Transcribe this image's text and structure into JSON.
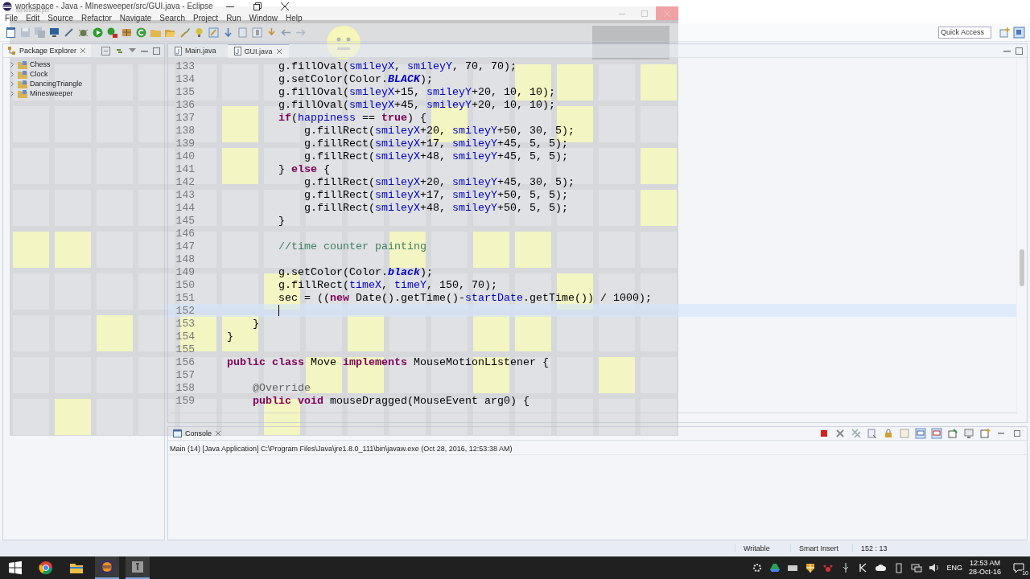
{
  "window": {
    "title": "workspace - Java - MInesweeper/src/GUI.java - Eclipse"
  },
  "menu": [
    "File",
    "Edit",
    "Source",
    "Refactor",
    "Navigate",
    "Search",
    "Project",
    "Run",
    "Window",
    "Help"
  ],
  "quick_access": {
    "placeholder": "Quick Access"
  },
  "package_explorer": {
    "title": "Package Explorer",
    "projects": [
      {
        "label": "Chess",
        "expanded": false
      },
      {
        "label": "Clock",
        "expanded": false
      },
      {
        "label": "DancingTriangle",
        "expanded": false
      },
      {
        "label": "Minesweeper",
        "expanded": false
      }
    ]
  },
  "editor": {
    "tabs": [
      {
        "label": "Main.java",
        "selected": false
      },
      {
        "label": "GUI.java",
        "selected": true
      }
    ],
    "lines": [
      {
        "number": "133",
        "current": false,
        "tokens": [
          {
            "kind": "plain",
            "text": "            g.fillOval("
          },
          {
            "kind": "field",
            "text": "smileyX"
          },
          {
            "kind": "plain",
            "text": ", "
          },
          {
            "kind": "field",
            "text": "smileyY"
          },
          {
            "kind": "plain",
            "text": ", 70, 70);"
          }
        ]
      },
      {
        "number": "134",
        "current": false,
        "tokens": [
          {
            "kind": "plain",
            "text": "            g.setColor(Color."
          },
          {
            "kind": "static",
            "text": "BLACK"
          },
          {
            "kind": "plain",
            "text": ");"
          }
        ]
      },
      {
        "number": "135",
        "current": false,
        "tokens": [
          {
            "kind": "plain",
            "text": "            g.fillOval("
          },
          {
            "kind": "field",
            "text": "smileyX"
          },
          {
            "kind": "plain",
            "text": "+15, "
          },
          {
            "kind": "field",
            "text": "smileyY"
          },
          {
            "kind": "plain",
            "text": "+20, 10, 10);"
          }
        ]
      },
      {
        "number": "136",
        "current": false,
        "tokens": [
          {
            "kind": "plain",
            "text": "            g.fillOval("
          },
          {
            "kind": "field",
            "text": "smileyX"
          },
          {
            "kind": "plain",
            "text": "+45, "
          },
          {
            "kind": "field",
            "text": "smileyY"
          },
          {
            "kind": "plain",
            "text": "+20, 10, 10);"
          }
        ]
      },
      {
        "number": "137",
        "current": false,
        "tokens": [
          {
            "kind": "keyword",
            "text": "            if"
          },
          {
            "kind": "plain",
            "text": "("
          },
          {
            "kind": "field",
            "text": "happiness"
          },
          {
            "kind": "plain",
            "text": " == "
          },
          {
            "kind": "keyword",
            "text": "true"
          },
          {
            "kind": "plain",
            "text": ") {"
          }
        ]
      },
      {
        "number": "138",
        "current": false,
        "tokens": [
          {
            "kind": "plain",
            "text": "                g.fillRect("
          },
          {
            "kind": "field",
            "text": "smileyX"
          },
          {
            "kind": "plain",
            "text": "+20, "
          },
          {
            "kind": "field",
            "text": "smileyY"
          },
          {
            "kind": "plain",
            "text": "+50, 30, 5);"
          }
        ]
      },
      {
        "number": "139",
        "current": false,
        "tokens": [
          {
            "kind": "plain",
            "text": "                g.fillRect("
          },
          {
            "kind": "field",
            "text": "smileyX"
          },
          {
            "kind": "plain",
            "text": "+17, "
          },
          {
            "kind": "field",
            "text": "smileyY"
          },
          {
            "kind": "plain",
            "text": "+45, 5, 5);"
          }
        ]
      },
      {
        "number": "140",
        "current": false,
        "tokens": [
          {
            "kind": "plain",
            "text": "                g.fillRect("
          },
          {
            "kind": "field",
            "text": "smileyX"
          },
          {
            "kind": "plain",
            "text": "+48, "
          },
          {
            "kind": "field",
            "text": "smileyY"
          },
          {
            "kind": "plain",
            "text": "+45, 5, 5);"
          }
        ]
      },
      {
        "number": "141",
        "current": false,
        "tokens": [
          {
            "kind": "plain",
            "text": "            } "
          },
          {
            "kind": "keyword",
            "text": "else"
          },
          {
            "kind": "plain",
            "text": " {"
          }
        ]
      },
      {
        "number": "142",
        "current": false,
        "tokens": [
          {
            "kind": "plain",
            "text": "                g.fillRect("
          },
          {
            "kind": "field",
            "text": "smileyX"
          },
          {
            "kind": "plain",
            "text": "+20, "
          },
          {
            "kind": "field",
            "text": "smileyY"
          },
          {
            "kind": "plain",
            "text": "+45, 30, 5);"
          }
        ]
      },
      {
        "number": "143",
        "current": false,
        "tokens": [
          {
            "kind": "plain",
            "text": "                g.fillRect("
          },
          {
            "kind": "field",
            "text": "smileyX"
          },
          {
            "kind": "plain",
            "text": "+17, "
          },
          {
            "kind": "field",
            "text": "smileyY"
          },
          {
            "kind": "plain",
            "text": "+50, 5, 5);"
          }
        ]
      },
      {
        "number": "144",
        "current": false,
        "tokens": [
          {
            "kind": "plain",
            "text": "                g.fillRect("
          },
          {
            "kind": "field",
            "text": "smileyX"
          },
          {
            "kind": "plain",
            "text": "+48, "
          },
          {
            "kind": "field",
            "text": "smileyY"
          },
          {
            "kind": "plain",
            "text": "+50, 5, 5);"
          }
        ]
      },
      {
        "number": "145",
        "current": false,
        "tokens": [
          {
            "kind": "plain",
            "text": "            }"
          }
        ]
      },
      {
        "number": "146",
        "current": false
      },
      {
        "number": "147",
        "current": false,
        "tokens": [
          {
            "kind": "comment",
            "text": "            //time counter painting"
          }
        ]
      },
      {
        "number": "148",
        "current": false
      },
      {
        "number": "149",
        "current": false,
        "tokens": [
          {
            "kind": "plain",
            "text": "            g.setColor(Color."
          },
          {
            "kind": "static",
            "text": "black"
          },
          {
            "kind": "plain",
            "text": ");"
          }
        ]
      },
      {
        "number": "150",
        "current": false,
        "tokens": [
          {
            "kind": "plain",
            "text": "            g.fillRect("
          },
          {
            "kind": "field",
            "text": "timeX"
          },
          {
            "kind": "plain",
            "text": ", "
          },
          {
            "kind": "field",
            "text": "timeY"
          },
          {
            "kind": "plain",
            "text": ", 150, 70);"
          }
        ]
      },
      {
        "number": "151",
        "current": false,
        "tokens": [
          {
            "kind": "plain",
            "text": "            sec = (("
          },
          {
            "kind": "keyword",
            "text": "new"
          },
          {
            "kind": "plain",
            "text": " Date().getTime()-"
          },
          {
            "kind": "field",
            "text": "startDate"
          },
          {
            "kind": "plain",
            "text": ".getTime()) / 1000);"
          }
        ]
      },
      {
        "number": "152",
        "current": true
      },
      {
        "number": "153",
        "current": false,
        "tokens": [
          {
            "kind": "plain",
            "text": "        }"
          }
        ]
      },
      {
        "number": "154",
        "current": false,
        "tokens": [
          {
            "kind": "plain",
            "text": "    }"
          }
        ]
      },
      {
        "number": "155",
        "current": false
      },
      {
        "number": "156",
        "current": false,
        "tokens": [
          {
            "kind": "keyword",
            "text": "    public class"
          },
          {
            "kind": "plain",
            "text": " Move "
          },
          {
            "kind": "keyword",
            "text": "implements"
          },
          {
            "kind": "plain",
            "text": " MouseMotionListener {"
          }
        ]
      },
      {
        "number": "157",
        "current": false
      },
      {
        "number": "158",
        "current": false,
        "tokens": [
          {
            "kind": "annotation",
            "text": "        @Override"
          }
        ]
      },
      {
        "number": "159",
        "current": false,
        "tokens": [
          {
            "kind": "keyword",
            "text": "        public void"
          },
          {
            "kind": "plain",
            "text": " mouseDragged(MouseEvent arg0) {"
          }
        ]
      }
    ]
  },
  "console": {
    "title": "Console",
    "description": "Main (14) [Java Application] C:\\Program Files\\Java\\jre1.8.0_111\\bin\\javaw.exe (Oct 28, 2016, 12:53:38 AM)"
  },
  "status_bar": {
    "mode": "Writable",
    "insert": "Smart Insert",
    "position": "152 : 13"
  },
  "taskbar": {
    "language": "ENG",
    "time": "12:53 AM",
    "date": "28-Oct-16",
    "notifications": "10"
  },
  "game": {
    "title": "Minesweeper",
    "rows": [
      {
        "cells": [
          {
            "lit": false
          },
          {
            "lit": false
          },
          {
            "lit": false
          },
          {
            "lit": false
          },
          {
            "lit": false
          },
          {
            "lit": false
          },
          {
            "lit": false
          },
          {
            "lit": false
          },
          {
            "lit": false
          },
          {
            "lit": false
          },
          {
            "lit": false
          },
          {
            "lit": false
          },
          {
            "lit": true
          },
          {
            "lit": true
          },
          {
            "lit": false
          },
          {
            "lit": true
          }
        ]
      },
      {
        "cells": [
          {
            "lit": false
          },
          {
            "lit": false
          },
          {
            "lit": false
          },
          {
            "lit": false
          },
          {
            "lit": false
          },
          {
            "lit": true
          },
          {
            "lit": false
          },
          {
            "lit": false
          },
          {
            "lit": false
          },
          {
            "lit": false
          },
          {
            "lit": true
          },
          {
            "lit": false
          },
          {
            "lit": false
          },
          {
            "lit": true
          },
          {
            "lit": false
          },
          {
            "lit": false
          }
        ]
      },
      {
        "cells": [
          {
            "lit": false
          },
          {
            "lit": false
          },
          {
            "lit": false
          },
          {
            "lit": false
          },
          {
            "lit": false
          },
          {
            "lit": true
          },
          {
            "lit": false
          },
          {
            "lit": false
          },
          {
            "lit": false
          },
          {
            "lit": false
          },
          {
            "lit": false
          },
          {
            "lit": false
          },
          {
            "lit": false
          },
          {
            "lit": false
          },
          {
            "lit": false
          },
          {
            "lit": true
          }
        ]
      },
      {
        "cells": [
          {
            "lit": false
          },
          {
            "lit": false
          },
          {
            "lit": false
          },
          {
            "lit": false
          },
          {
            "lit": false
          },
          {
            "lit": false
          },
          {
            "lit": false
          },
          {
            "lit": false
          },
          {
            "lit": false
          },
          {
            "lit": false
          },
          {
            "lit": false
          },
          {
            "lit": false
          },
          {
            "lit": false
          },
          {
            "lit": false
          },
          {
            "lit": false
          },
          {
            "lit": true
          }
        ]
      },
      {
        "cells": [
          {
            "lit": true
          },
          {
            "lit": true
          },
          {
            "lit": false
          },
          {
            "lit": false
          },
          {
            "lit": false
          },
          {
            "lit": false
          },
          {
            "lit": false
          },
          {
            "lit": false
          },
          {
            "lit": false
          },
          {
            "lit": true
          },
          {
            "lit": false
          },
          {
            "lit": true
          },
          {
            "lit": true
          },
          {
            "lit": false
          },
          {
            "lit": false
          },
          {
            "lit": false
          }
        ]
      },
      {
        "cells": [
          {
            "lit": false
          },
          {
            "lit": false
          },
          {
            "lit": false
          },
          {
            "lit": false
          },
          {
            "lit": false
          },
          {
            "lit": false
          },
          {
            "lit": true
          },
          {
            "lit": false
          },
          {
            "lit": false
          },
          {
            "lit": false
          },
          {
            "lit": false
          },
          {
            "lit": false
          },
          {
            "lit": false
          },
          {
            "lit": true
          },
          {
            "lit": false
          },
          {
            "lit": false
          }
        ]
      },
      {
        "cells": [
          {
            "lit": false
          },
          {
            "lit": false
          },
          {
            "lit": true
          },
          {
            "lit": false
          },
          {
            "lit": true
          },
          {
            "lit": true
          },
          {
            "lit": false
          },
          {
            "lit": false
          },
          {
            "lit": true
          },
          {
            "lit": false
          },
          {
            "lit": false
          },
          {
            "lit": true
          },
          {
            "lit": true
          },
          {
            "lit": false
          },
          {
            "lit": false
          },
          {
            "lit": false
          }
        ]
      },
      {
        "cells": [
          {
            "lit": false
          },
          {
            "lit": false
          },
          {
            "lit": false
          },
          {
            "lit": false
          },
          {
            "lit": false
          },
          {
            "lit": false
          },
          {
            "lit": false
          },
          {
            "lit": true
          },
          {
            "lit": true
          },
          {
            "lit": false
          },
          {
            "lit": false
          },
          {
            "lit": true
          },
          {
            "lit": false
          },
          {
            "lit": false
          },
          {
            "lit": true
          },
          {
            "lit": false
          }
        ]
      },
      {
        "cells": [
          {
            "lit": false
          },
          {
            "lit": true
          },
          {
            "lit": false
          },
          {
            "lit": false
          },
          {
            "lit": false
          },
          {
            "lit": false
          },
          {
            "lit": true
          },
          {
            "lit": false
          },
          {
            "lit": false
          },
          {
            "lit": false
          },
          {
            "lit": false
          },
          {
            "lit": false
          },
          {
            "lit": false
          },
          {
            "lit": false
          },
          {
            "lit": false
          },
          {
            "lit": false
          }
        ]
      }
    ]
  }
}
